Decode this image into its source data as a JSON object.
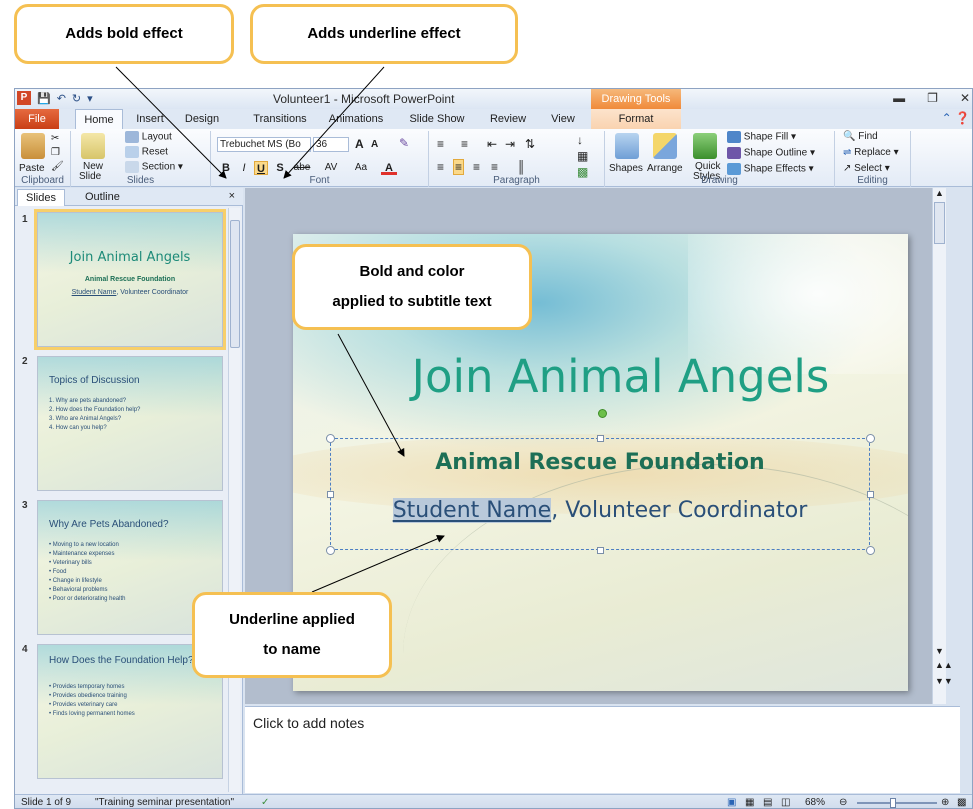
{
  "callouts": {
    "bold": "Adds bold effect",
    "underline": "Adds underline effect",
    "subtitle_line1": "Bold and color",
    "subtitle_line2": "applied to subtitle text",
    "name_line1": "Underline applied",
    "name_line2": "to name"
  },
  "window": {
    "title": "Volunteer1 - Microsoft PowerPoint",
    "contextual_header": "Drawing Tools",
    "app_icon": "P",
    "qat": [
      "save-icon",
      "undo-icon",
      "redo-icon",
      "customize-icon"
    ]
  },
  "tabs": {
    "file": "File",
    "items": [
      "Home",
      "Insert",
      "Design",
      "Transitions",
      "Animations",
      "Slide Show",
      "Review",
      "View"
    ],
    "format": "Format",
    "active": "Home"
  },
  "ribbon": {
    "clipboard": {
      "label": "Clipboard",
      "paste": "Paste"
    },
    "slides": {
      "label": "Slides",
      "new_slide": "New",
      "new_slide2": "Slide",
      "layout": "Layout",
      "reset": "Reset",
      "section": "Section"
    },
    "font": {
      "label": "Font",
      "font_name": "Trebuchet MS (Bo",
      "font_size": "36",
      "bold": "B",
      "italic": "I",
      "underline": "U",
      "shadow": "S",
      "strike": "abe",
      "spacing": "AV",
      "case": "Aa",
      "color": "A",
      "grow": "A",
      "shrink": "A"
    },
    "paragraph": {
      "label": "Paragraph"
    },
    "drawing": {
      "label": "Drawing",
      "shapes": "Shapes",
      "arrange": "Arrange",
      "quick": "Quick",
      "styles": "Styles",
      "shape_fill": "Shape Fill",
      "shape_outline": "Shape Outline",
      "shape_effects": "Shape Effects"
    },
    "editing": {
      "label": "Editing",
      "find": "Find",
      "replace": "Replace",
      "select": "Select"
    }
  },
  "slides_pane": {
    "tab_slides": "Slides",
    "tab_outline": "Outline",
    "close": "×",
    "slides": [
      {
        "num": "1",
        "title": "Join Animal Angels",
        "sub1": "Animal Rescue Foundation",
        "sub2_name": "Student Name",
        "sub2_rest": ", Volunteer Coordinator"
      },
      {
        "num": "2",
        "title": "Topics of Discussion",
        "bullets": [
          "1.  Why are pets abandoned?",
          "2.  How does the Foundation help?",
          "3.  Who are Animal Angels?",
          "4.  How can you help?"
        ]
      },
      {
        "num": "3",
        "title": "Why Are Pets Abandoned?",
        "bullets": [
          "• Moving to a new location",
          "• Maintenance expenses",
          "   • Veterinary bills",
          "   • Food",
          "• Change in lifestyle",
          "• Behavioral problems",
          "• Poor or deteriorating health"
        ]
      },
      {
        "num": "4",
        "title": "How Does the Foundation Help?",
        "bullets": [
          "• Provides temporary homes",
          "• Provides obedience training",
          "• Provides veterinary care",
          "• Finds loving permanent homes"
        ]
      }
    ]
  },
  "slide": {
    "title": "Join Animal Angels",
    "subtitle_line1": "Animal Rescue Foundation",
    "subtitle_name": "Student Name",
    "subtitle_rest": ", Volunteer Coordinator"
  },
  "notes": {
    "placeholder": "Click to add notes"
  },
  "status": {
    "slide_of": "Slide 1 of 9",
    "theme": "\"Training seminar presentation\"",
    "zoom": "68%"
  },
  "colors": {
    "accent_orange": "#f5c052",
    "file_tab": "#d24726",
    "title_green": "#1f9f84"
  }
}
